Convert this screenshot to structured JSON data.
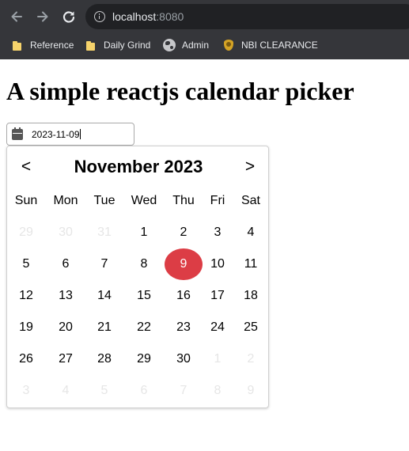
{
  "browser": {
    "url_host": "localhost",
    "url_port": ":8080",
    "bookmarks": [
      {
        "label": "Reference",
        "icon": "folder-icon"
      },
      {
        "label": "Daily Grind",
        "icon": "folder-icon"
      },
      {
        "label": "Admin",
        "icon": "globe-icon"
      },
      {
        "label": "NBI CLEARANCE",
        "icon": "shield-icon"
      }
    ]
  },
  "page": {
    "title": "A simple reactjs calendar picker"
  },
  "date_input": {
    "value": "2023-11-09",
    "icon": "calendar-icon"
  },
  "calendar": {
    "prev_label": "<",
    "next_label": ">",
    "month_label": "November 2023",
    "weekdays": [
      "Sun",
      "Mon",
      "Tue",
      "Wed",
      "Thu",
      "Fri",
      "Sat"
    ],
    "weeks": [
      [
        {
          "d": "29",
          "out": true
        },
        {
          "d": "30",
          "out": true
        },
        {
          "d": "31",
          "out": true
        },
        {
          "d": "1"
        },
        {
          "d": "2"
        },
        {
          "d": "3"
        },
        {
          "d": "4"
        }
      ],
      [
        {
          "d": "5"
        },
        {
          "d": "6"
        },
        {
          "d": "7"
        },
        {
          "d": "8"
        },
        {
          "d": "9",
          "selected": true
        },
        {
          "d": "10"
        },
        {
          "d": "11"
        }
      ],
      [
        {
          "d": "12"
        },
        {
          "d": "13"
        },
        {
          "d": "14"
        },
        {
          "d": "15"
        },
        {
          "d": "16"
        },
        {
          "d": "17"
        },
        {
          "d": "18"
        }
      ],
      [
        {
          "d": "19"
        },
        {
          "d": "20"
        },
        {
          "d": "21"
        },
        {
          "d": "22"
        },
        {
          "d": "23"
        },
        {
          "d": "24"
        },
        {
          "d": "25"
        }
      ],
      [
        {
          "d": "26"
        },
        {
          "d": "27"
        },
        {
          "d": "28"
        },
        {
          "d": "29"
        },
        {
          "d": "30"
        },
        {
          "d": "1",
          "out": true
        },
        {
          "d": "2",
          "out": true
        }
      ],
      [
        {
          "d": "3",
          "out": true
        },
        {
          "d": "4",
          "out": true
        },
        {
          "d": "5",
          "out": true
        },
        {
          "d": "6",
          "out": true
        },
        {
          "d": "7",
          "out": true
        },
        {
          "d": "8",
          "out": true
        },
        {
          "d": "9",
          "out": true
        }
      ]
    ],
    "selected_color": "#dc3d45",
    "outside_day_color": "#e6e6e6"
  }
}
